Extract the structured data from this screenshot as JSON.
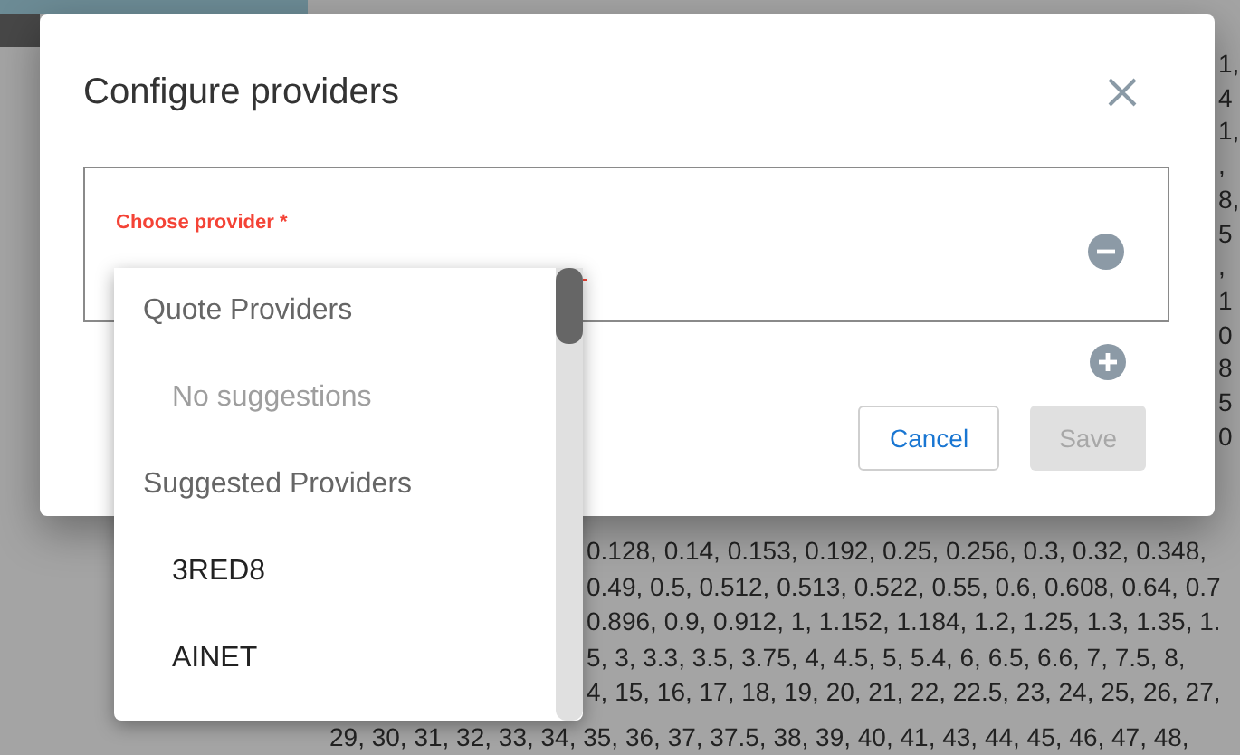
{
  "background": {
    "edge_fragments": [
      "1,",
      "4",
      "1,",
      ",",
      "8,",
      "5",
      ",",
      "1",
      "0",
      "8",
      "5",
      "0"
    ],
    "lines": [
      "0.128, 0.14, 0.153, 0.192, 0.25, 0.256, 0.3, 0.32, 0.348,",
      "0.49, 0.5, 0.512, 0.513, 0.522, 0.55, 0.6, 0.608, 0.64, 0.7",
      "0.896, 0.9, 0.912, 1, 1.152, 1.184, 1.2, 1.25, 1.3, 1.35, 1.",
      "5, 3, 3.3, 3.5, 3.75, 4, 4.5, 5, 5.4, 6, 6.5, 6.6, 7, 7.5, 8,",
      "4, 15, 16, 17, 18, 19, 20, 21, 22, 22.5, 23, 24, 25, 26, 27,",
      "29, 30, 31, 32, 33, 34, 35, 36, 37, 37.5, 38, 39, 40, 41, 43, 44, 45, 46, 47, 48,"
    ]
  },
  "dialog": {
    "title": "Configure providers"
  },
  "provider_field": {
    "label": "Choose provider *"
  },
  "dropdown": {
    "groups": [
      {
        "header": "Quote Providers",
        "items": [
          {
            "label": "No suggestions",
            "kind": "empty"
          }
        ]
      },
      {
        "header": "Suggested Providers",
        "items": [
          {
            "label": "3RED8",
            "kind": "option"
          },
          {
            "label": "AINET",
            "kind": "option"
          }
        ]
      }
    ]
  },
  "buttons": [
    {
      "label": "Cancel",
      "disabled": false
    },
    {
      "label": "Save",
      "disabled": true
    }
  ]
}
